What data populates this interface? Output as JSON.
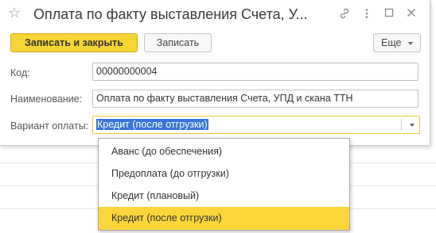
{
  "window": {
    "title": "Оплата по факту выставления Счета, У...",
    "favorite_icon": "star-icon",
    "link_icon": "link-icon",
    "more_icon": "more-dots-icon",
    "maximize_icon": "maximize-icon",
    "close_icon": "close-icon"
  },
  "toolbar": {
    "save_close_label": "Записать и закрыть",
    "save_label": "Записать",
    "more_label": "Еще",
    "more_icon": "chevron-down-icon"
  },
  "form": {
    "code_label": "Код:",
    "code_value": "00000000004",
    "name_label": "Наименование:",
    "name_value": "Оплата по факту выставления Счета, УПД и скана ТТН",
    "payment_label": "Вариант оплаты:",
    "payment_value": "Кредит (после отгрузки)"
  },
  "dropdown": {
    "options": [
      "Аванс (до обеспечения)",
      "Предоплата (до отгрузки)",
      "Кредит (плановый)",
      "Кредит (после отгрузки)"
    ],
    "selected_index": 3
  },
  "colors": {
    "accent": "#f7d533",
    "selection": "#3875d7",
    "highlight": "#fad63b"
  }
}
